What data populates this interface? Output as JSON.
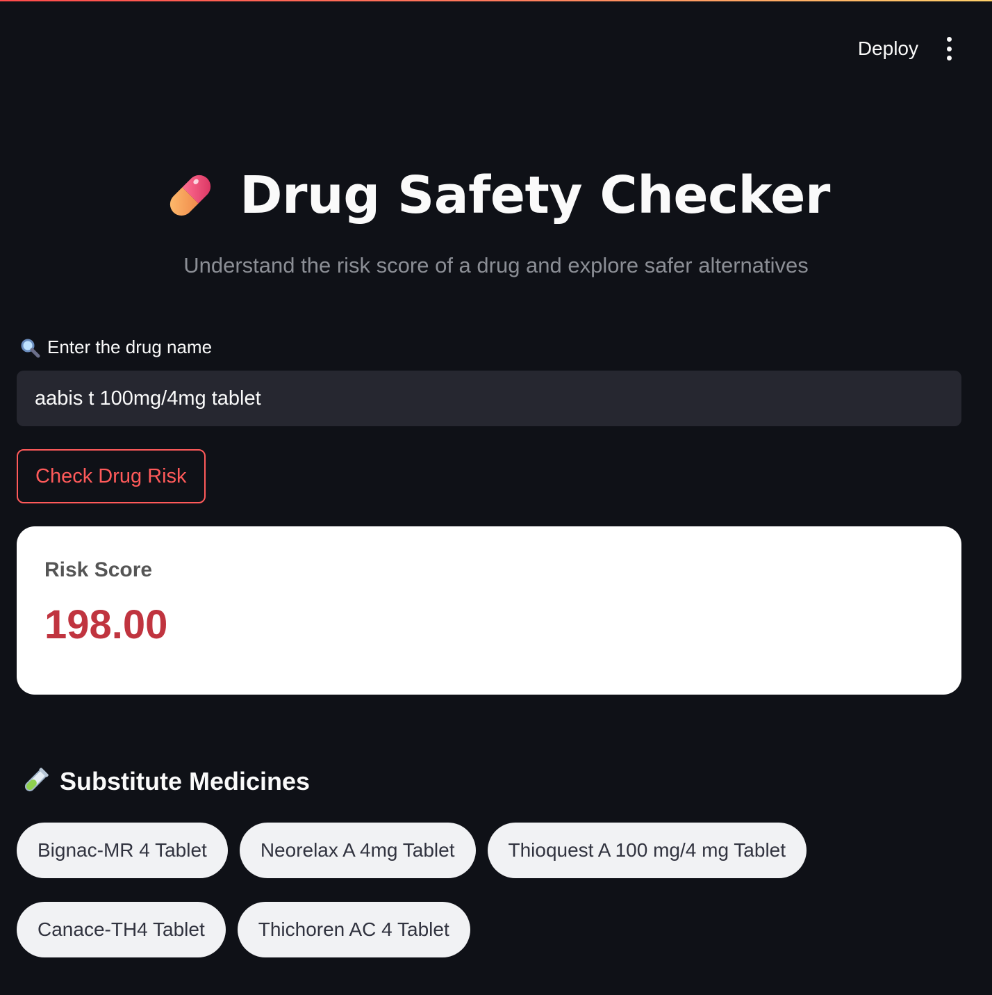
{
  "toolbar": {
    "deploy_label": "Deploy",
    "menu_icon": "more-vertical-icon"
  },
  "header": {
    "icon": "pill-icon",
    "title": "Drug Safety Checker",
    "subtitle": "Understand the risk score of a drug and explore safer alternatives"
  },
  "search": {
    "icon": "magnifier-icon",
    "label": "Enter the drug name",
    "value": "aabis t 100mg/4mg tablet"
  },
  "check_button": {
    "label": "Check Drug Risk"
  },
  "risk": {
    "label": "Risk Score",
    "value": "198.00"
  },
  "substitutes": {
    "icon": "test-tube-icon",
    "heading": "Substitute Medicines",
    "items": [
      "Bignac-MR 4 Tablet",
      "Neorelax A 4mg Tablet",
      "Thioquest A 100 mg/4 mg Tablet",
      "Canace-TH4 Tablet",
      "Thichoren AC 4 Tablet"
    ]
  },
  "colors": {
    "background": "#0f1117",
    "accent": "#ff5a5a",
    "risk_value": "#c0343f",
    "chip_background": "#f1f2f4"
  }
}
